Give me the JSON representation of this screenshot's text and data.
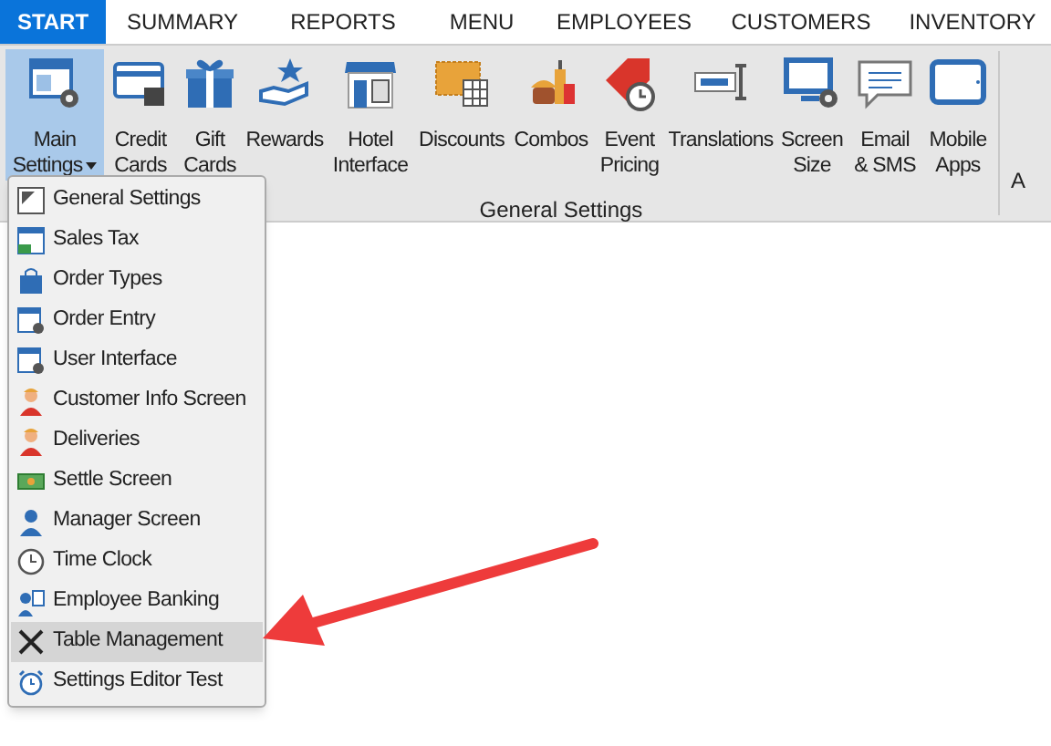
{
  "tabs": [
    {
      "label": "START",
      "selected": true
    },
    {
      "label": "SUMMARY",
      "selected": false
    },
    {
      "label": "REPORTS",
      "selected": false
    },
    {
      "label": "MENU",
      "selected": false
    },
    {
      "label": "EMPLOYEES",
      "selected": false
    },
    {
      "label": "CUSTOMERS",
      "selected": false
    },
    {
      "label": "INVENTORY",
      "selected": false
    }
  ],
  "ribbon": {
    "buttons": [
      {
        "lines": [
          "Main",
          "Settings"
        ],
        "selected": true,
        "dropdown": true
      },
      {
        "lines": [
          "Credit",
          "Cards"
        ],
        "selected": false,
        "dropdown": false
      },
      {
        "lines": [
          "Gift",
          "Cards"
        ],
        "selected": false,
        "dropdown": false
      },
      {
        "lines": [
          "Rewards"
        ],
        "selected": false,
        "dropdown": false
      },
      {
        "lines": [
          "Hotel",
          "Interface"
        ],
        "selected": false,
        "dropdown": false
      },
      {
        "lines": [
          "Discounts"
        ],
        "selected": false,
        "dropdown": false
      },
      {
        "lines": [
          "Combos"
        ],
        "selected": false,
        "dropdown": false
      },
      {
        "lines": [
          "Event",
          "Pricing"
        ],
        "selected": false,
        "dropdown": false
      },
      {
        "lines": [
          "Translations"
        ],
        "selected": false,
        "dropdown": false
      },
      {
        "lines": [
          "Screen",
          "Size"
        ],
        "selected": false,
        "dropdown": false
      },
      {
        "lines": [
          "Email",
          "& SMS"
        ],
        "selected": false,
        "dropdown": false
      },
      {
        "lines": [
          "Mobile",
          "Apps"
        ],
        "selected": false,
        "dropdown": false
      }
    ],
    "group_label": "General Settings",
    "next_group_cut": "A"
  },
  "menu": {
    "items": [
      {
        "label": "General Settings",
        "selected": false
      },
      {
        "label": "Sales Tax",
        "selected": false
      },
      {
        "label": "Order Types",
        "selected": false
      },
      {
        "label": "Order Entry",
        "selected": false
      },
      {
        "label": "User Interface",
        "selected": false
      },
      {
        "label": "Customer Info Screen",
        "selected": false
      },
      {
        "label": "Deliveries",
        "selected": false
      },
      {
        "label": "Settle Screen",
        "selected": false
      },
      {
        "label": "Manager Screen",
        "selected": false
      },
      {
        "label": "Time Clock",
        "selected": false
      },
      {
        "label": "Employee Banking",
        "selected": false
      },
      {
        "label": "Table Management",
        "selected": true
      },
      {
        "label": "Settings Editor Test",
        "selected": false
      }
    ]
  }
}
